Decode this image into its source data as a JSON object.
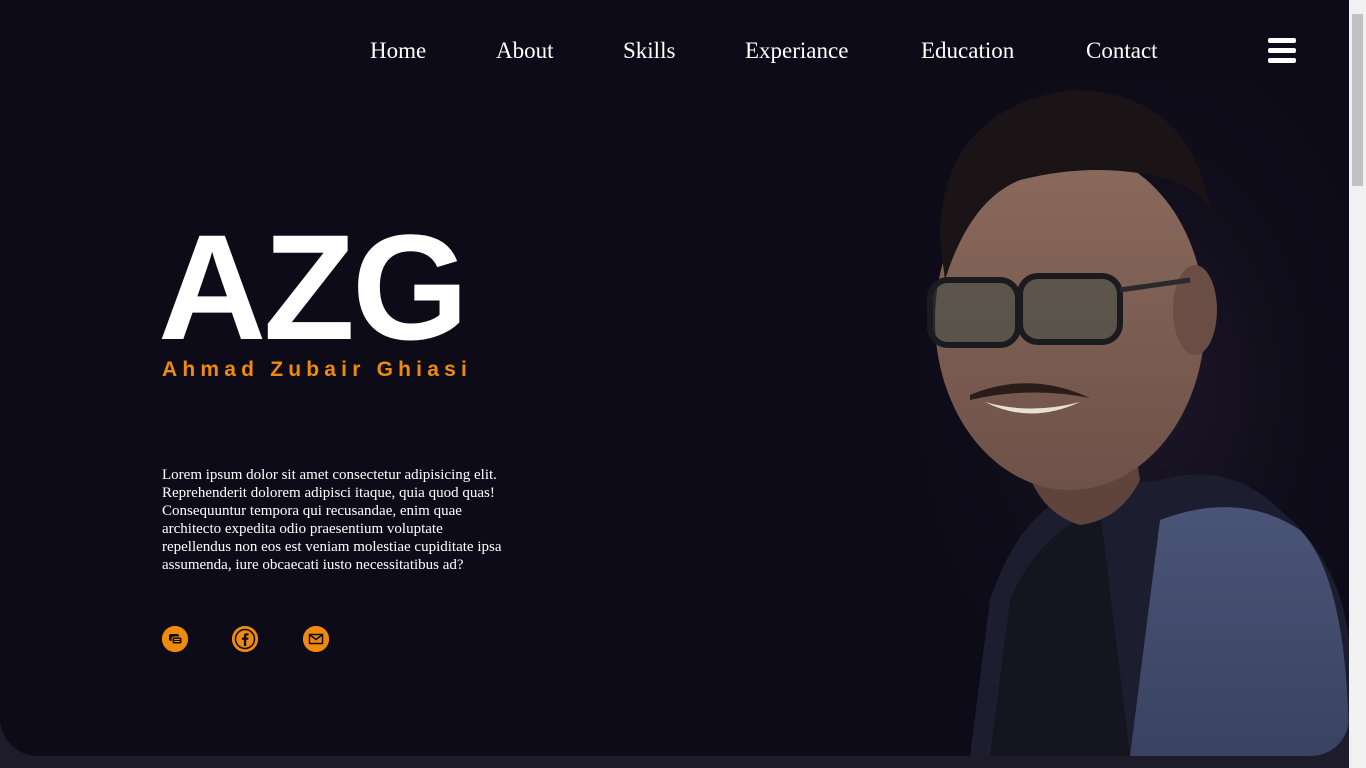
{
  "nav": {
    "items": [
      {
        "label": "Home"
      },
      {
        "label": "About"
      },
      {
        "label": "Skills"
      },
      {
        "label": "Experiance"
      },
      {
        "label": "Education"
      },
      {
        "label": "Contact"
      }
    ],
    "menu_icon": "hamburger-menu-icon"
  },
  "hero": {
    "logo": "AZG",
    "name": "Ahmad Zubair Ghiasi",
    "description": "Lorem ipsum dolor sit amet consectetur adipisicing elit. Reprehenderit dolorem adipisci itaque, quia quod quas! Consequuntur tempora qui recusandae, enim quae architecto expedita odio praesentium voluptate repellendus non eos est veniam molestiae cupiditate ipsa assumenda, iure obcaecati iusto necessitatibus ad?",
    "social": [
      {
        "icon": "chat-icon"
      },
      {
        "icon": "facebook-icon"
      },
      {
        "icon": "mail-icon"
      }
    ]
  },
  "colors": {
    "background": "#0d0b18",
    "accent": "#f08a0c",
    "text": "#ffffff"
  }
}
